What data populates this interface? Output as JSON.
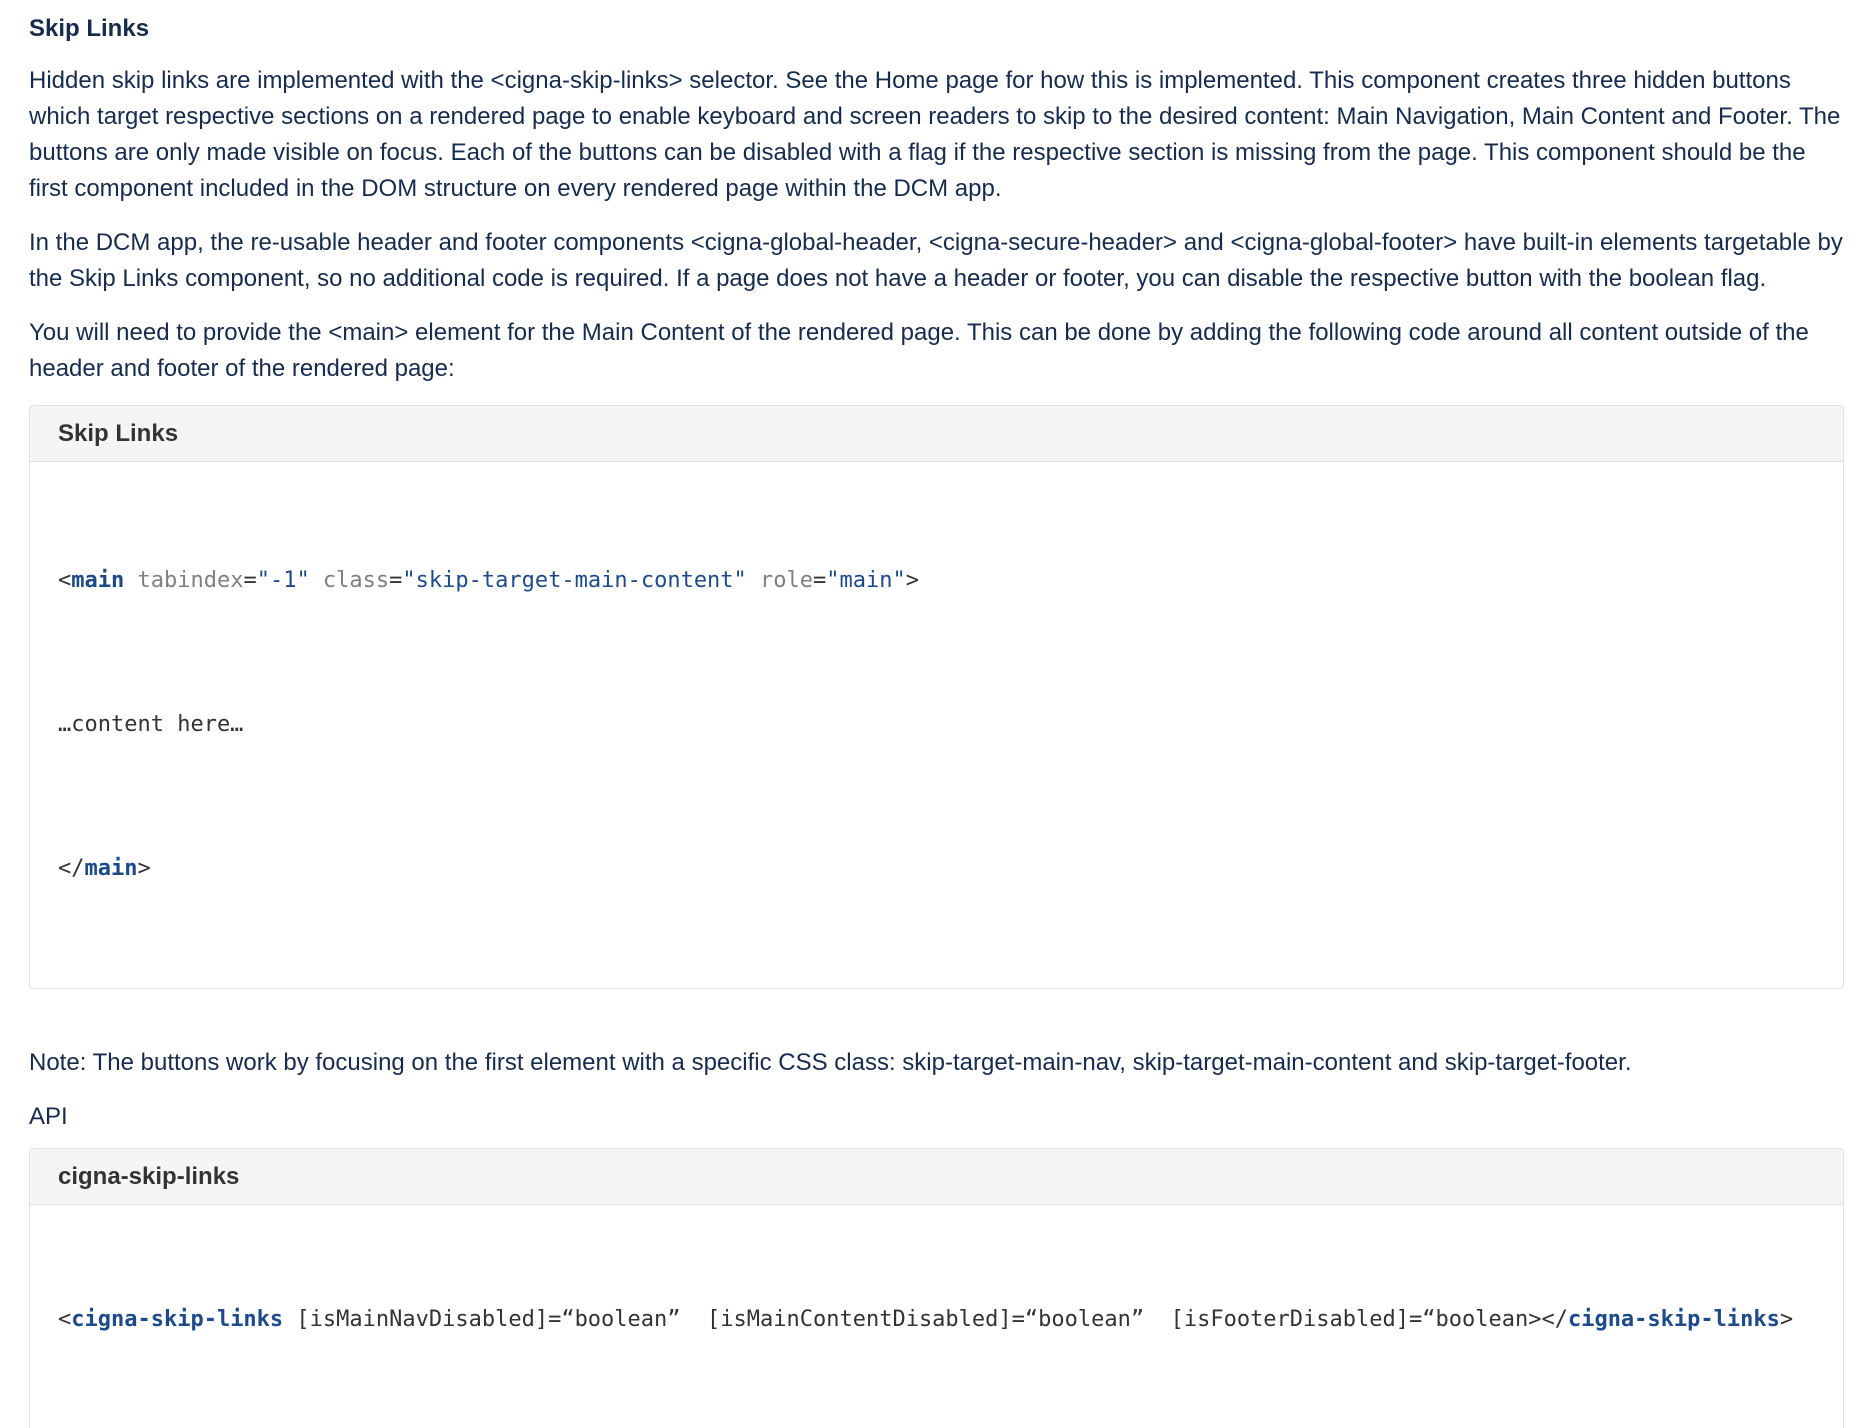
{
  "heading": "Skip Links",
  "paragraphs": {
    "p1": "Hidden skip links are implemented with the <cigna-skip-links> selector. See the Home page for how this is implemented. This component creates three hidden buttons which target respective sections on a rendered page to enable keyboard and screen readers to skip to the desired content: Main Navigation, Main Content and Footer. The buttons are only made visible on focus. Each of the buttons can be disabled with a flag if the respective section is missing from the page.  This component should be the first component included in the DOM structure on every rendered page within the DCM app.",
    "p2": "In the DCM app, the re-usable header and footer components <cigna-global-header, <cigna-secure-header> and <cigna-global-footer> have built-in elements targetable by the Skip Links component, so no additional code is required. If a page does not have a header or footer, you can disable the respective button with the boolean flag.",
    "p3": "You will need to provide the <main> element for the Main Content of the rendered page. This can be done by adding the following code around all content outside of the header and footer of the rendered page:",
    "note": "Note: The buttons work by focusing on the first element with a specific CSS class: skip-target-main-nav, skip-target-main-content and skip-target-footer.",
    "api": "API"
  },
  "code_panel_1": {
    "title": "Skip Links",
    "line1": {
      "lt": "<",
      "tag": "main",
      "attr1": " tabindex",
      "eq1": "=",
      "val1": "\"-1\"",
      "attr2": " class",
      "eq2": "=",
      "val2": "\"skip-target-main-content\"",
      "attr3": " role",
      "eq3": "=",
      "val3": "\"main\"",
      "gt": ">"
    },
    "line2": "…content here…",
    "line3": {
      "lt": "</",
      "tag": "main",
      "gt": ">"
    }
  },
  "code_panel_2": {
    "title": "cigna-skip-links",
    "line1": {
      "lt": "<",
      "tag": "cigna-skip-links",
      "rest": " [isMainNavDisabled]=“boolean”  [isMainContentDisabled]=“boolean”  [isFooterDisabled]=“boolean></",
      "end_tag": "cigna-skip-links",
      "gt": ">"
    }
  }
}
